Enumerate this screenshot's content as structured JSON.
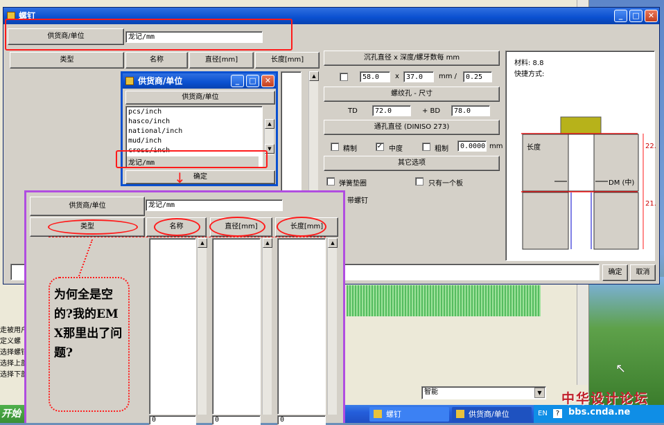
{
  "desktop": {
    "left_text": [
      "走被用户",
      "定义螺",
      "选择螺钉",
      "选择上部",
      "选择下部"
    ],
    "dropdown_value": "智能",
    "watermark": "中华设计论坛",
    "watermark_url": "bbs.cnda.ne"
  },
  "taskbar": {
    "start_label": "开始",
    "items": [
      "螺钉",
      "供货商/单位"
    ],
    "lang": "EN"
  },
  "main_window": {
    "title": "螺钉",
    "supplier_button": "供货商/单位",
    "supplier_value": "龙记/mm",
    "columns": [
      "类型",
      "名称",
      "直径[mm]",
      "长度[mm]"
    ],
    "counterbore_header": "沉孔直径 x 深度/螺牙数每 mm",
    "counterbore_values": [
      "58.0",
      "37.0",
      "0.25"
    ],
    "x_sign": "x",
    "mm_slash": "mm /",
    "thread_header": "螺纹孔 - 尺寸",
    "td_label": "TD",
    "td_value": "72.0",
    "bd_label": "+ BD",
    "bd_value": "78.0",
    "through_header": "通孔直径 (DINISO 273)",
    "fit_options": [
      "精制",
      "中度",
      "粗制"
    ],
    "fit_checked": [
      false,
      true,
      false
    ],
    "fit_value": "0.0000",
    "mm_unit": "mm",
    "other_header": "其它选项",
    "spring_washer": "弹簧垫圈",
    "only_one_plate": "只有一个板",
    "plate_screw": "带螺钉",
    "info_material": "材料: 8.8",
    "info_quick": "快捷方式:",
    "diagram": {
      "length_label": "长度",
      "dm_label": "DM (中)",
      "dim_top": "22.",
      "dim_bottom": "21."
    },
    "ok_button": "确定",
    "cancel_button": "取消"
  },
  "supplier_dialog": {
    "title": "供货商/单位",
    "header": "供货商/单位",
    "items": [
      "pcs/inch",
      "hasco/inch",
      "national/inch",
      "mud/inch",
      "cross/inch",
      "龙记/mm"
    ],
    "selected_index": 5,
    "ok_button": "确定"
  },
  "zoom_panel": {
    "supplier_button": "供货商/单位",
    "supplier_value": "龙记/mm",
    "columns": [
      "类型",
      "名称",
      "直径[mm]",
      "长度[mm]"
    ],
    "col_footer": "0"
  },
  "annotation": {
    "text": "为何全是空的?我的EMX那里出了问题?"
  },
  "colors": {
    "accent_red": "#ff1a1a",
    "purple_frame": "#b04de0",
    "xp_blue": "#0a50d0",
    "dialog_bg": "#d4d0c8"
  }
}
